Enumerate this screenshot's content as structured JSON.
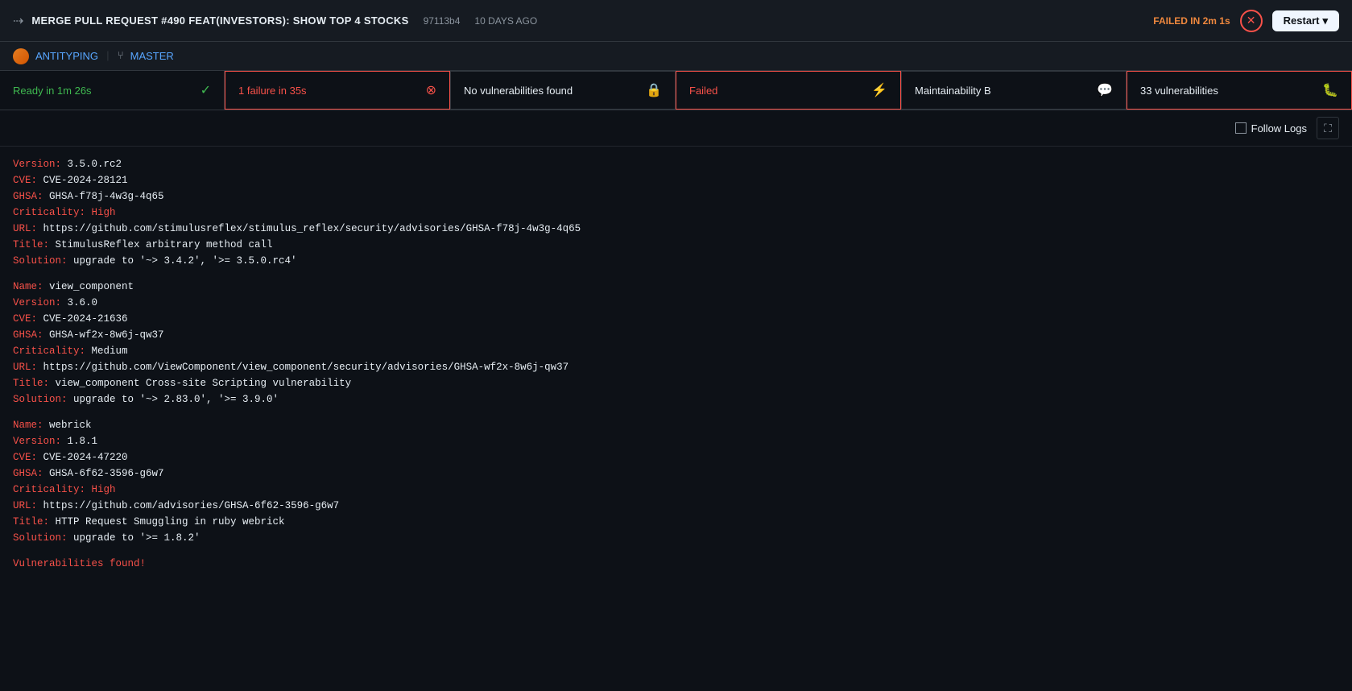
{
  "header": {
    "icon": "⇢",
    "pr_title": "MERGE PULL REQUEST #490 FEAT(INVESTORS): SHOW TOP 4 STOCKS",
    "commit": "97113b4",
    "time_ago": "10 DAYS AGO",
    "failed_label": "FAILED IN 2m 1s",
    "restart_label": "Restart"
  },
  "sub_header": {
    "org_name": "ANTITYPING",
    "branch_name": "MASTER"
  },
  "tabs": [
    {
      "label": "Ready in 1m 26s",
      "icon": "✓",
      "type": "success"
    },
    {
      "label": "1 failure in 35s",
      "icon": "⊗",
      "type": "failure"
    },
    {
      "label": "No vulnerabilities found",
      "icon": "🔒",
      "type": "no-vuln"
    },
    {
      "label": "Failed",
      "icon": "⚡",
      "type": "failed-red"
    },
    {
      "label": "Maintainability B",
      "icon": "💬",
      "type": "maintain"
    },
    {
      "label": "33 vulnerabilities",
      "icon": "🐛",
      "type": "vuln-warn"
    }
  ],
  "toolbar": {
    "follow_logs_label": "Follow Logs"
  },
  "log": {
    "entries": [
      {
        "type": "kv",
        "key": "Version:",
        "val": " 3.5.0.rc2",
        "val_class": "val"
      },
      {
        "type": "kv",
        "key": "CVE:",
        "val": " CVE-2024-28121",
        "val_class": "val"
      },
      {
        "type": "kv",
        "key": "GHSA:",
        "val": " GHSA-f78j-4w3g-4q65",
        "val_class": "val"
      },
      {
        "type": "kv",
        "key": "Criticality:",
        "val": " High",
        "val_class": "val-high"
      },
      {
        "type": "kv",
        "key": "URL:",
        "val": " https://github.com/stimulusreflex/stimulus_reflex/security/advisories/GHSA-f78j-4w3g-4q65",
        "val_class": "val"
      },
      {
        "type": "kv",
        "key": "Title:",
        "val": " StimulusReflex arbitrary method call",
        "val_class": "val"
      },
      {
        "type": "kv",
        "key": "Solution:",
        "val": " upgrade to '~> 3.4.2', '>= 3.5.0.rc4'",
        "val_class": "val"
      },
      {
        "type": "blank"
      },
      {
        "type": "kv",
        "key": "Name:",
        "val": " view_component",
        "val_class": "val"
      },
      {
        "type": "kv",
        "key": "Version:",
        "val": " 3.6.0",
        "val_class": "val"
      },
      {
        "type": "kv",
        "key": "CVE:",
        "val": " CVE-2024-21636",
        "val_class": "val"
      },
      {
        "type": "kv",
        "key": "GHSA:",
        "val": " GHSA-wf2x-8w6j-qw37",
        "val_class": "val"
      },
      {
        "type": "kv",
        "key": "Criticality:",
        "val": " Medium",
        "val_class": "val-medium"
      },
      {
        "type": "kv",
        "key": "URL:",
        "val": " https://github.com/ViewComponent/view_component/security/advisories/GHSA-wf2x-8w6j-qw37",
        "val_class": "val"
      },
      {
        "type": "kv",
        "key": "Title:",
        "val": " view_component Cross-site Scripting vulnerability",
        "val_class": "val"
      },
      {
        "type": "kv",
        "key": "Solution:",
        "val": " upgrade to '~> 2.83.0', '>= 3.9.0'",
        "val_class": "val"
      },
      {
        "type": "blank"
      },
      {
        "type": "kv",
        "key": "Name:",
        "val": " webrick",
        "val_class": "val"
      },
      {
        "type": "kv",
        "key": "Version:",
        "val": " 1.8.1",
        "val_class": "val"
      },
      {
        "type": "kv",
        "key": "CVE:",
        "val": " CVE-2024-47220",
        "val_class": "val"
      },
      {
        "type": "kv",
        "key": "GHSA:",
        "val": " GHSA-6f62-3596-g6w7",
        "val_class": "val"
      },
      {
        "type": "kv",
        "key": "Criticality:",
        "val": " High",
        "val_class": "val-high"
      },
      {
        "type": "kv",
        "key": "URL:",
        "val": " https://github.com/advisories/GHSA-6f62-3596-g6w7",
        "val_class": "val"
      },
      {
        "type": "kv",
        "key": "Title:",
        "val": " HTTP Request Smuggling in ruby webrick",
        "val_class": "val"
      },
      {
        "type": "kv",
        "key": "Solution:",
        "val": " upgrade to '>= 1.8.2'",
        "val_class": "val"
      },
      {
        "type": "blank"
      },
      {
        "type": "text",
        "text": "Vulnerabilities found!",
        "text_class": "val-found"
      }
    ]
  }
}
